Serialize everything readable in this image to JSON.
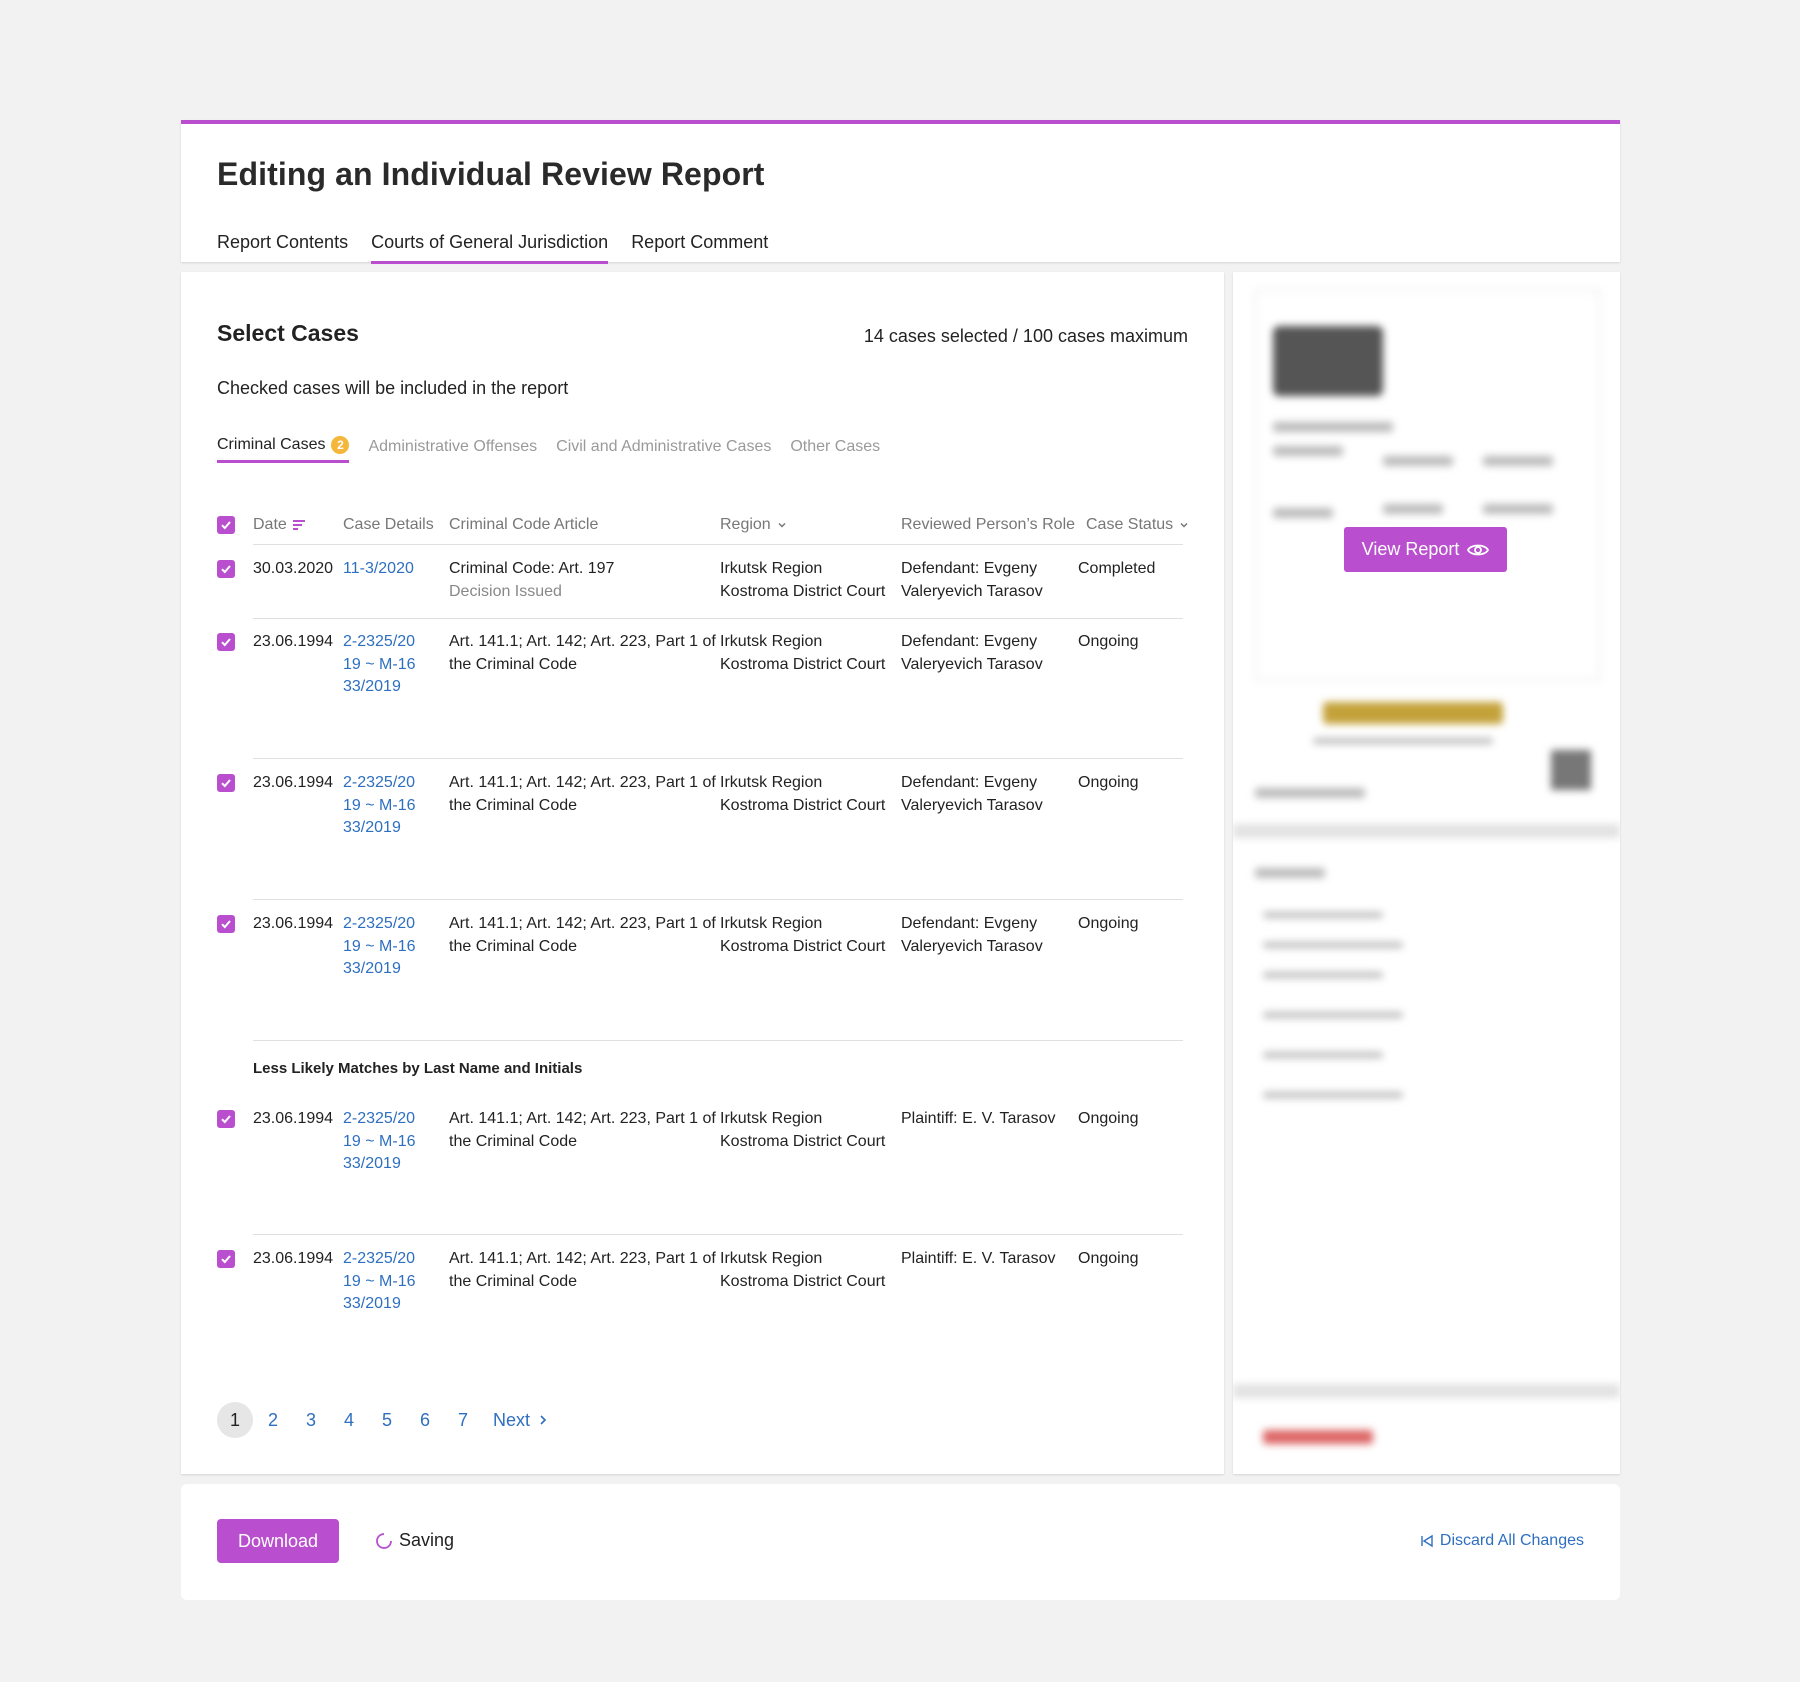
{
  "page": {
    "title": "Editing an Individual Review Report",
    "tabs": [
      {
        "label": "Report Contents"
      },
      {
        "label": "Courts of General Jurisdiction"
      },
      {
        "label": "Report Comment"
      }
    ]
  },
  "cases": {
    "title": "Select Cases",
    "selection_count": "14 cases selected / 100 cases maximum",
    "subtitle": "Checked cases will be included in the report",
    "tabs": [
      {
        "label": "Criminal Cases",
        "badge": "2"
      },
      {
        "label": "Administrative Offenses"
      },
      {
        "label": "Civil and Administrative Cases"
      },
      {
        "label": "Other Cases"
      }
    ],
    "columns": {
      "date": "Date",
      "case_details": "Case Details",
      "article": "Criminal Code Article",
      "region": "Region",
      "role": "Reviewed Person’s Role",
      "status": "Case Status"
    },
    "rows": [
      {
        "date": "30.03.2020",
        "case": "11-3/2020",
        "article": "Criminal Code: Art. 197",
        "article_sub": "Decision Issued",
        "region": "Irkutsk Region",
        "court": "Kostroma District Court",
        "role": "Defendant: Evgeny Valeryevich Tarasov",
        "status": "Completed"
      },
      {
        "date": "23.06.1994",
        "case": "2-2325/2019 ~ M-1633/2019",
        "article": "Art. 141.1; Art. 142; Art. 223, Part 1 of the Criminal Code",
        "region": "Irkutsk Region",
        "court": "Kostroma District Court",
        "role": "Defendant: Evgeny Valeryevich Tarasov",
        "status": "Ongoing"
      },
      {
        "date": "23.06.1994",
        "case": "2-2325/2019 ~ M-1633/2019",
        "article": "Art. 141.1; Art. 142; Art. 223, Part 1 of the Criminal Code",
        "region": "Irkutsk Region",
        "court": "Kostroma District Court",
        "role": "Defendant: Evgeny Valeryevich Tarasov",
        "status": "Ongoing"
      },
      {
        "date": "23.06.1994",
        "case": "2-2325/2019 ~ M-1633/2019",
        "article": "Art. 141.1; Art. 142; Art. 223, Part 1 of the Criminal Code",
        "region": "Irkutsk Region",
        "court": "Kostroma District Court",
        "role": "Defendant: Evgeny Valeryevich Tarasov",
        "status": "Ongoing"
      }
    ],
    "group_title": "Less Likely Matches by Last Name and Initials",
    "rows_less_likely": [
      {
        "date": "23.06.1994",
        "case": "2-2325/2019 ~ M-1633/2019",
        "article": "Art. 141.1; Art. 142; Art. 223, Part 1 of the Criminal Code",
        "region": "Irkutsk Region",
        "court": "Kostroma District Court",
        "role": "Plaintiff: E. V. Tarasov",
        "status": "Ongoing"
      },
      {
        "date": "23.06.1994",
        "case": "2-2325/2019 ~ M-1633/2019",
        "article": "Art. 141.1; Art. 142; Art. 223, Part 1 of the Criminal Code",
        "region": "Irkutsk Region",
        "court": "Kostroma District Court",
        "role": "Plaintiff: E. V. Tarasov",
        "status": "Ongoing"
      }
    ],
    "pagination": {
      "pages": [
        "1",
        "2",
        "3",
        "4",
        "5",
        "6",
        "7"
      ],
      "current": "1",
      "next_label": "Next"
    }
  },
  "preview": {
    "view_report_label": "View Report"
  },
  "footer": {
    "download_label": "Download",
    "saving_label": "Saving",
    "discard_label": "Discard All Changes"
  },
  "colors": {
    "accent": "#b94fcf",
    "link": "#2e6fc0",
    "badge": "#f5b73b"
  }
}
